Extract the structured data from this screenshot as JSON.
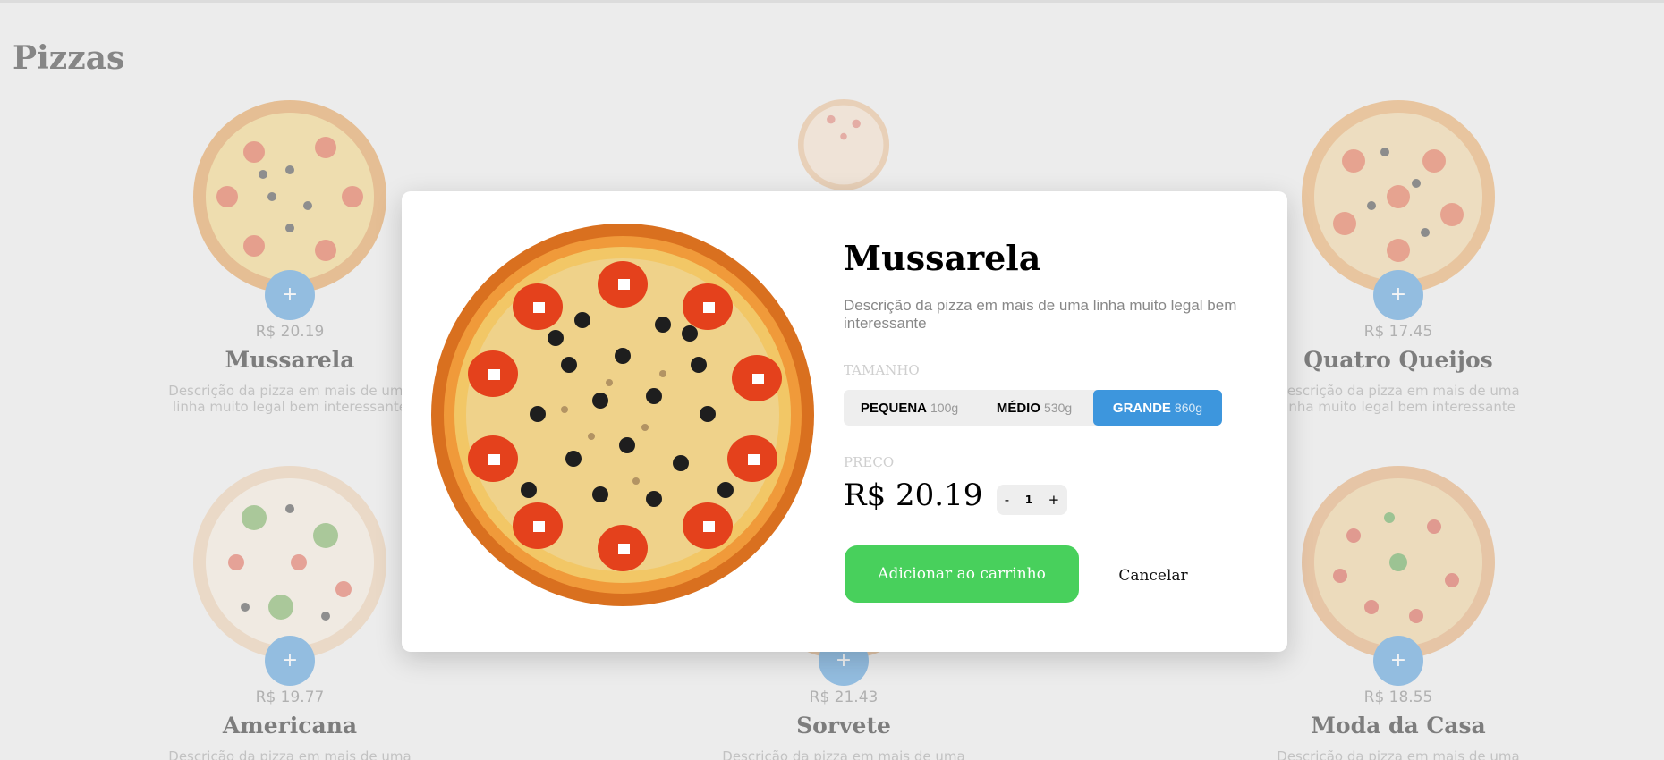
{
  "page": {
    "title": "Pizzas"
  },
  "pizzas": [
    {
      "name": "Mussarela",
      "price": "R$ 20.19",
      "desc": "Descrição da pizza em mais de uma linha muito legal bem interessante"
    },
    {
      "name": "",
      "price": "",
      "desc": ""
    },
    {
      "name": "Quatro Queijos",
      "price": "R$ 17.45",
      "desc": "Descrição da pizza em mais de uma linha muito legal bem interessante"
    },
    {
      "name": "Americana",
      "price": "R$ 19.77",
      "desc": "Descrição da pizza em mais de uma"
    },
    {
      "name": "Sorvete",
      "price": "R$ 21.43",
      "desc": "Descrição da pizza em mais de uma"
    },
    {
      "name": "Moda da Casa",
      "price": "R$ 18.55",
      "desc": "Descrição da pizza em mais de uma"
    }
  ],
  "add_icon": "+",
  "modal": {
    "title": "Mussarela",
    "description": "Descrição da pizza em mais de uma linha muito legal bem interessante",
    "size_label": "TAMANHO",
    "sizes": [
      {
        "name": "PEQUENA",
        "weight": "100g"
      },
      {
        "name": "MÉDIO",
        "weight": "530g"
      },
      {
        "name": "GRANDE",
        "weight": "860g"
      }
    ],
    "selected_size": "GRANDE",
    "price_label": "PREÇO",
    "price": "R$ 20.19",
    "qty_minus": "-",
    "qty_value": "1",
    "qty_plus": "+",
    "add_button": "Adicionar ao carrinho",
    "cancel_button": "Cancelar"
  },
  "colors": {
    "accent_blue": "#3d96dd",
    "add_green": "#48d05c",
    "background": "#ececec"
  }
}
